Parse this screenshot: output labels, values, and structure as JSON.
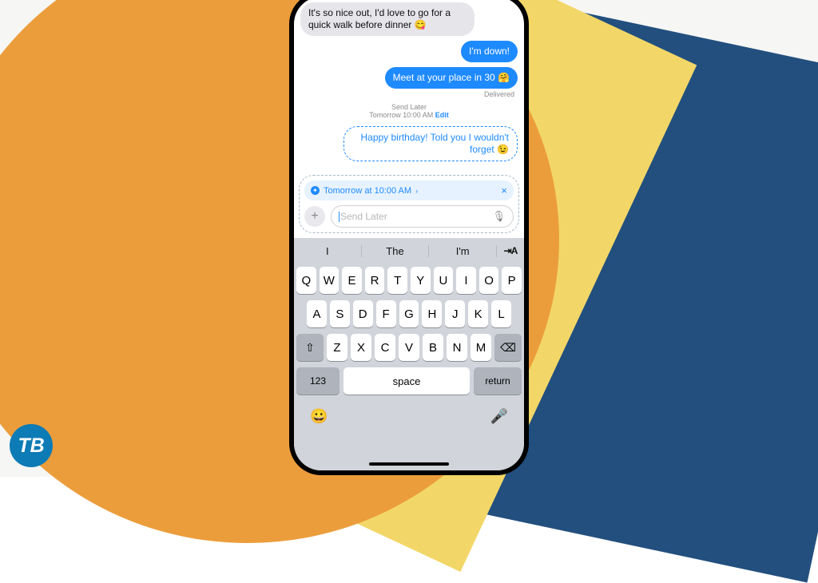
{
  "chat": {
    "incoming1": "It's so nice out, I'd love to go for a quick walk before dinner 😋",
    "outgoing1": "I'm down!",
    "outgoing2": "Meet at your place in 30 🤗",
    "delivered": "Delivered",
    "sendlater_title": "Send Later",
    "sendlater_time": "Tomorrow 10:00 AM",
    "sendlater_edit": "Edit",
    "draft_msg": "Happy birthday! Told you I wouldn't forget 😉"
  },
  "compose": {
    "schedule_label": "Tomorrow at 10:00 AM",
    "schedule_chevron": "›",
    "close": "×",
    "plus": "+",
    "placeholder": "Send Later"
  },
  "keyboard": {
    "suggest": {
      "s1": "I",
      "s2": "The",
      "s3": "I'm"
    },
    "autocorrect": "⇥A",
    "rows": {
      "r1": [
        "Q",
        "W",
        "E",
        "R",
        "T",
        "Y",
        "U",
        "I",
        "O",
        "P"
      ],
      "r2": [
        "A",
        "S",
        "D",
        "F",
        "G",
        "H",
        "J",
        "K",
        "L"
      ],
      "r3": [
        "Z",
        "X",
        "C",
        "V",
        "B",
        "N",
        "M"
      ]
    },
    "shift": "⇧",
    "backspace": "⌫",
    "numbers": "123",
    "space": "space",
    "return": "return",
    "emoji": "😀",
    "mic": "🎤"
  },
  "logo": "TB"
}
